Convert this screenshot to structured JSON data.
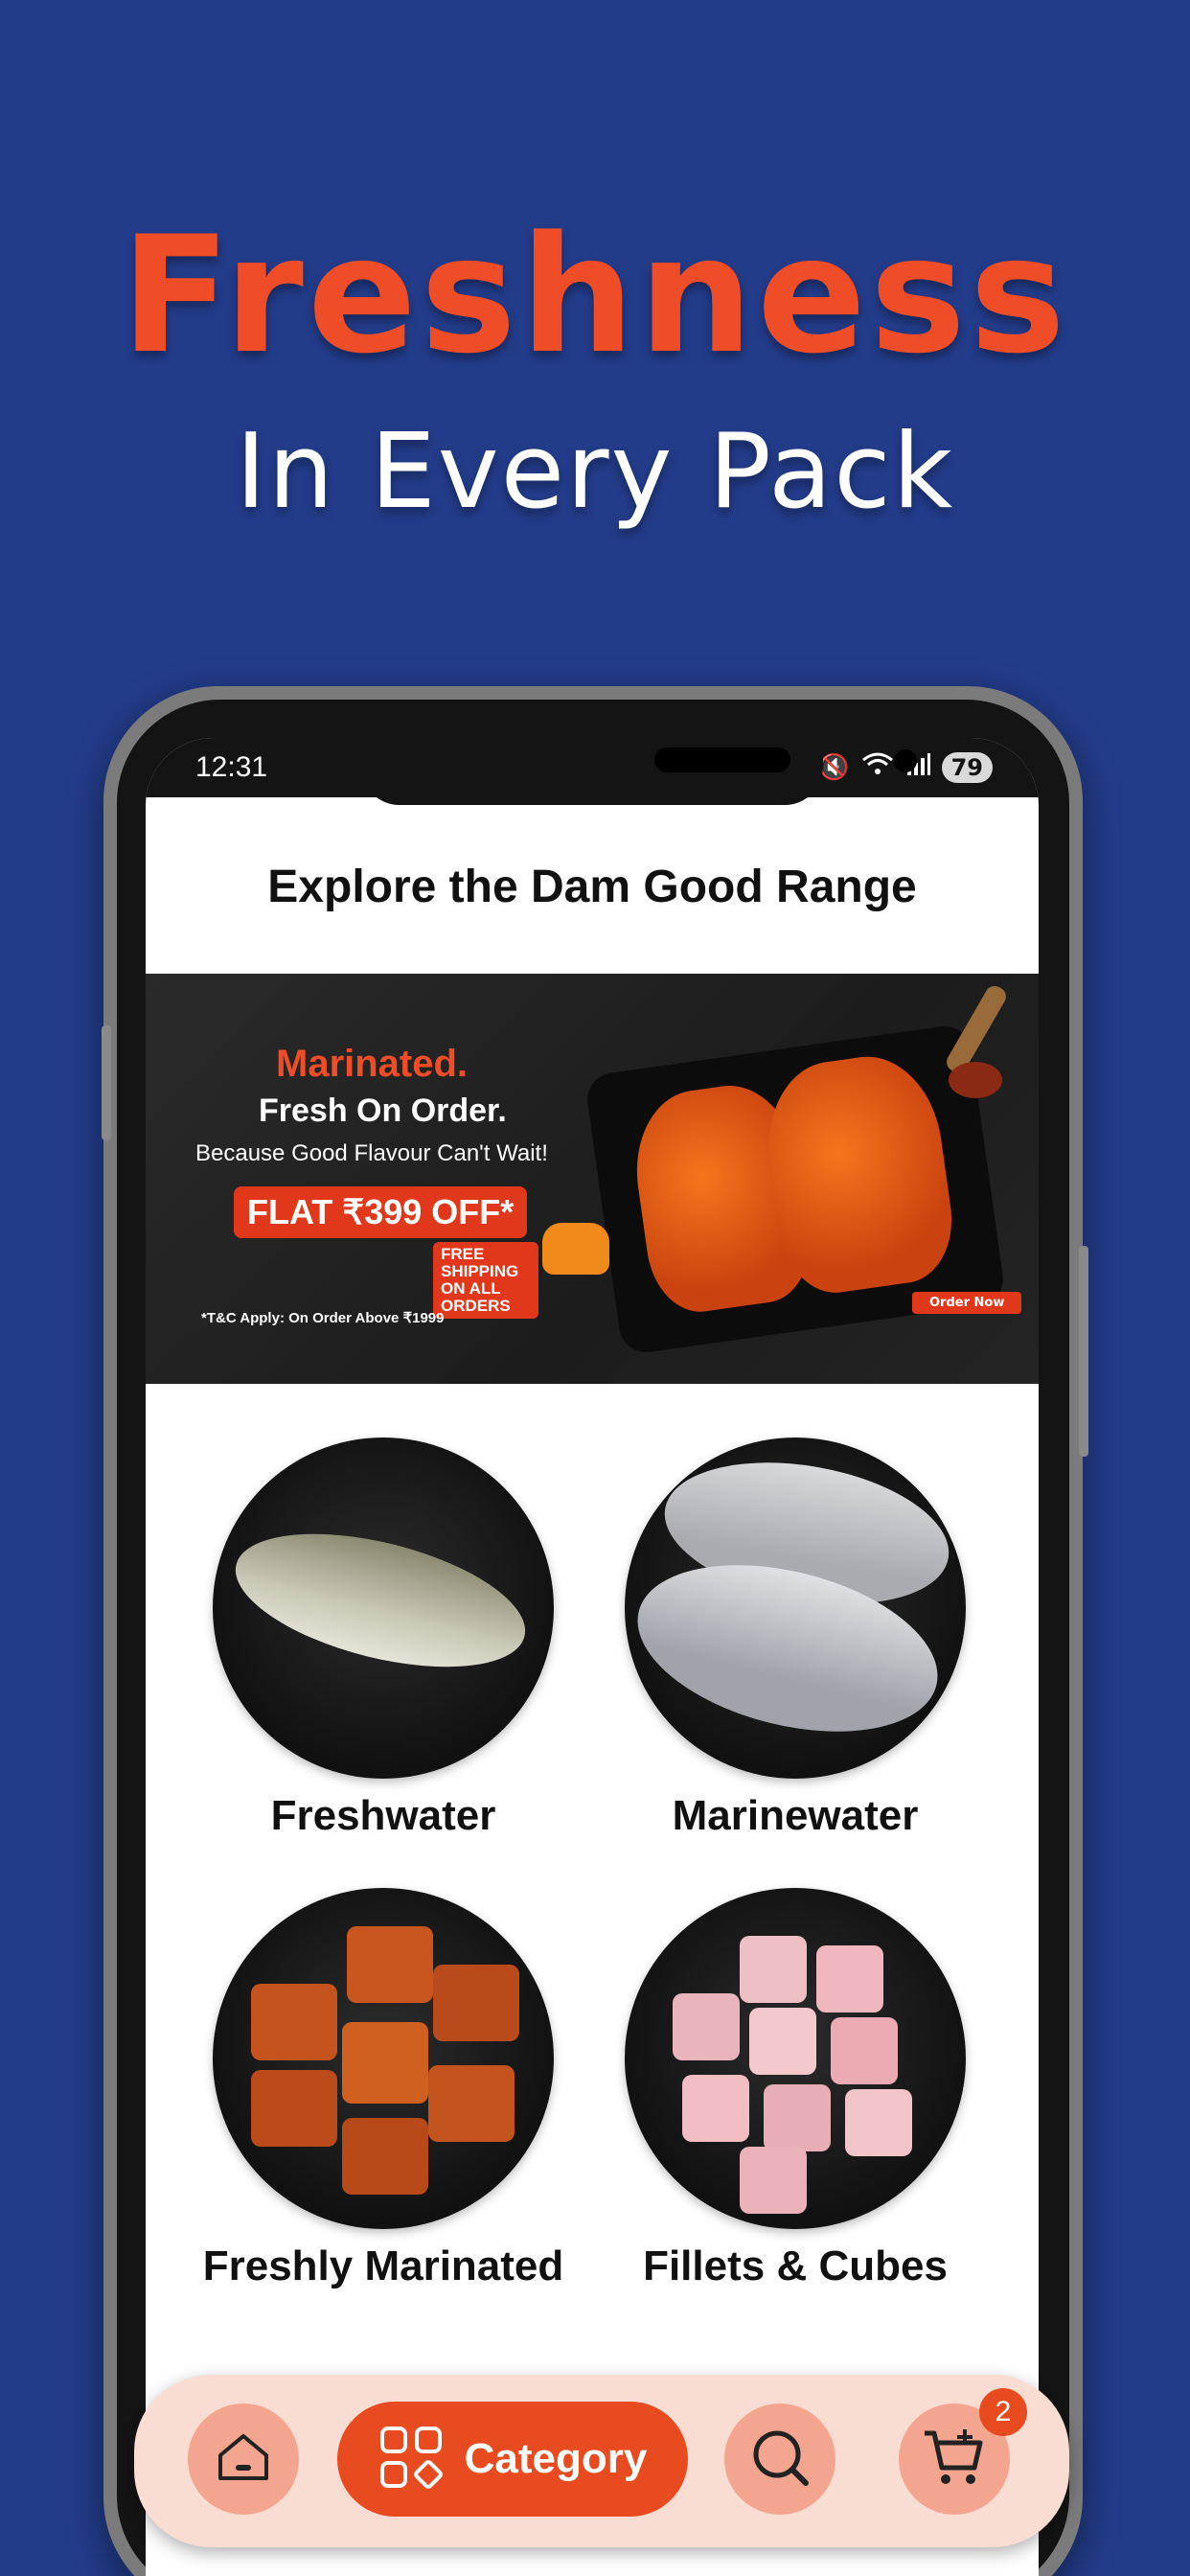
{
  "promo": {
    "headline": "Freshness",
    "subline": "In Every Pack"
  },
  "statusbar": {
    "time": "12:31",
    "battery": "79"
  },
  "page": {
    "title": "Explore the Dam Good Range"
  },
  "banner": {
    "line1": "Marinated.",
    "line2": "Fresh On Order.",
    "line3": "Because Good Flavour Can't Wait!",
    "offer": "FLAT ₹399 OFF*",
    "shipping": "FREE SHIPPING ON ALL ORDERS",
    "terms": "*T&C Apply: On Order Above ₹1999",
    "cta": "Order Now"
  },
  "categories": [
    {
      "label": "Freshwater"
    },
    {
      "label": "Marinewater"
    },
    {
      "label": "Freshly Marinated"
    },
    {
      "label": "Fillets & Cubes"
    }
  ],
  "nav": {
    "category_label": "Category",
    "cart_count": "2"
  },
  "colors": {
    "background": "#233c8a",
    "accent": "#ef4d27",
    "nav_bg": "#f9ddd3"
  }
}
